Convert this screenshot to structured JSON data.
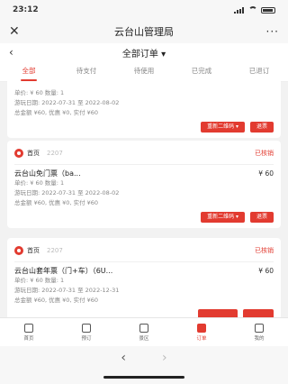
{
  "status_bar": {
    "time": "23:12"
  },
  "header": {
    "title": "云台山管理局",
    "close": "✕",
    "more": "···"
  },
  "sub_header": {
    "back": "‹",
    "title": "全部订单 ▾"
  },
  "tabs": [
    "全部",
    "待支付",
    "待使用",
    "已完成",
    "已退订"
  ],
  "orders": [
    {
      "store": "",
      "order_no": "",
      "status": "",
      "item_name": "",
      "price": "",
      "unit_qty": "单价: ¥ 60    数量: 1",
      "validity": "游玩日期: 2022-07-31 至 2022-08-02",
      "total": "总金额 ¥60, 优惠 ¥0,  实付 ¥60",
      "btn_again": "重新二维码 ▾",
      "btn_more": "退票"
    },
    {
      "store": "首页",
      "order_no": "2207",
      "status": "已核销",
      "item_name": "云台山免门票（ba...",
      "price": "¥ 60",
      "unit_qty": "单价: ¥ 60    数量: 1",
      "validity": "游玩日期: 2022-07-31 至 2022-08-02",
      "total": "总金额 ¥60, 优惠 ¥0,  实付 ¥60",
      "btn_again": "重新二维码 ▾",
      "btn_more": "退票"
    },
    {
      "store": "首页",
      "order_no": "2207",
      "status": "已核销",
      "item_name": "云台山套年票（门+车）（6U...",
      "price": "¥ 60",
      "unit_qty": "单价: ¥ 60    数量: 1",
      "validity": "游玩日期: 2022-07-31 至 2022-12-31",
      "total": "总金额 ¥60, 优惠 ¥0,  实付 ¥60",
      "btn_again": "",
      "btn_more": ""
    }
  ],
  "bottom_nav": [
    {
      "label": "首页",
      "icon": "home-icon"
    },
    {
      "label": "预订",
      "icon": "booking-icon"
    },
    {
      "label": "景区",
      "icon": "scenic-icon"
    },
    {
      "label": "订单",
      "icon": "order-icon"
    },
    {
      "label": "我的",
      "icon": "profile-icon"
    }
  ],
  "browser_bar": {
    "back": "‹",
    "forward": "›"
  }
}
